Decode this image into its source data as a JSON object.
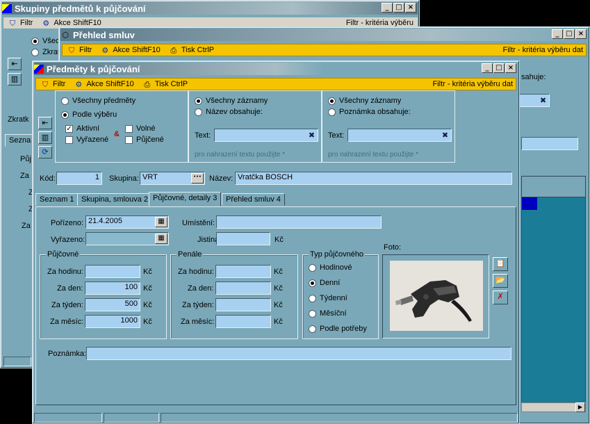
{
  "win_skupiny": {
    "title": "Skupiny předmětů k půjčování",
    "filtr": "Filtr",
    "akce": "Akce ShiftF10",
    "filtr_right": "Filtr - kritéria výběru",
    "radio1": "Všec",
    "radio2": "Zkrat",
    "label_zkratka": "Zkratk",
    "tab_seznam": "Sezna",
    "group_pujc": "Půj",
    "za1": "Za",
    "za2": "Z",
    "za3": "Z",
    "za4": "Za"
  },
  "win_prehled": {
    "title": "Přehled smluv",
    "filtr": "Filtr",
    "akce": "Akce ShiftF10",
    "tisk": "Tisk CtrlP",
    "filtr_right": "Filtr - kritéria výběru dat",
    "obsahuje": "sahuje:"
  },
  "win_predmety": {
    "title": "Předměty k půjčování",
    "menu": {
      "filtr": "Filtr",
      "akce": "Akce ShiftF10",
      "tisk": "Tisk CtrlP",
      "filtr_right": "Filtr - kritéria výběru dat"
    },
    "filter1": {
      "all": "Všechny předměty",
      "sel": "Podle výběru",
      "aktivni": "Aktivní",
      "volne": "Volné",
      "vyrazene": "Vyřazené",
      "pujcene": "Půjčené",
      "amp": "&"
    },
    "filter2": {
      "all": "Všechny záznamy",
      "name": "Název obsahuje:",
      "text": "Text:",
      "hint": "pro nahrazení textu použijte *"
    },
    "filter3": {
      "all": "Všechny záznamy",
      "note": "Poznámka obsahuje:",
      "text": "Text:",
      "hint": "pro nahrazení textu použijte *"
    },
    "kod_label": "Kód:",
    "kod": "1",
    "skupina_label": "Skupina:",
    "skupina": "VRT",
    "nazev_label": "Název:",
    "nazev": "Vratčka BOSCH",
    "tabs": [
      "Seznam 1",
      "Skupina, smlouva 2",
      "Půjčovné, detaily 3",
      "Přehled smluv 4"
    ],
    "porizeno_label": "Pořízeno:",
    "porizeno": "21.4.2005",
    "vyrazeno_label": "Vyřazeno:",
    "umisteni_label": "Umístění:",
    "jistina_label": "Jistina:",
    "kc": "Kč",
    "pujcovne": {
      "title": "Půjčovné",
      "hod": "Za hodinu:",
      "den": "Za den:",
      "tyden": "Za týden:",
      "mesic": "Za měsíc:",
      "v_den": "100",
      "v_tyden": "500",
      "v_mesic": "1000"
    },
    "penale": {
      "title": "Penále",
      "hod": "Za hodinu:",
      "den": "Za den:",
      "tyden": "Za týden:",
      "mesic": "Za měsíc:"
    },
    "typ": {
      "title": "Typ půjčovného",
      "opts": [
        "Hodinové",
        "Denní",
        "Týdenní",
        "Měsíční",
        "Podle potřeby"
      ]
    },
    "foto_label": "Foto:",
    "poznamka_label": "Poznámka:"
  }
}
